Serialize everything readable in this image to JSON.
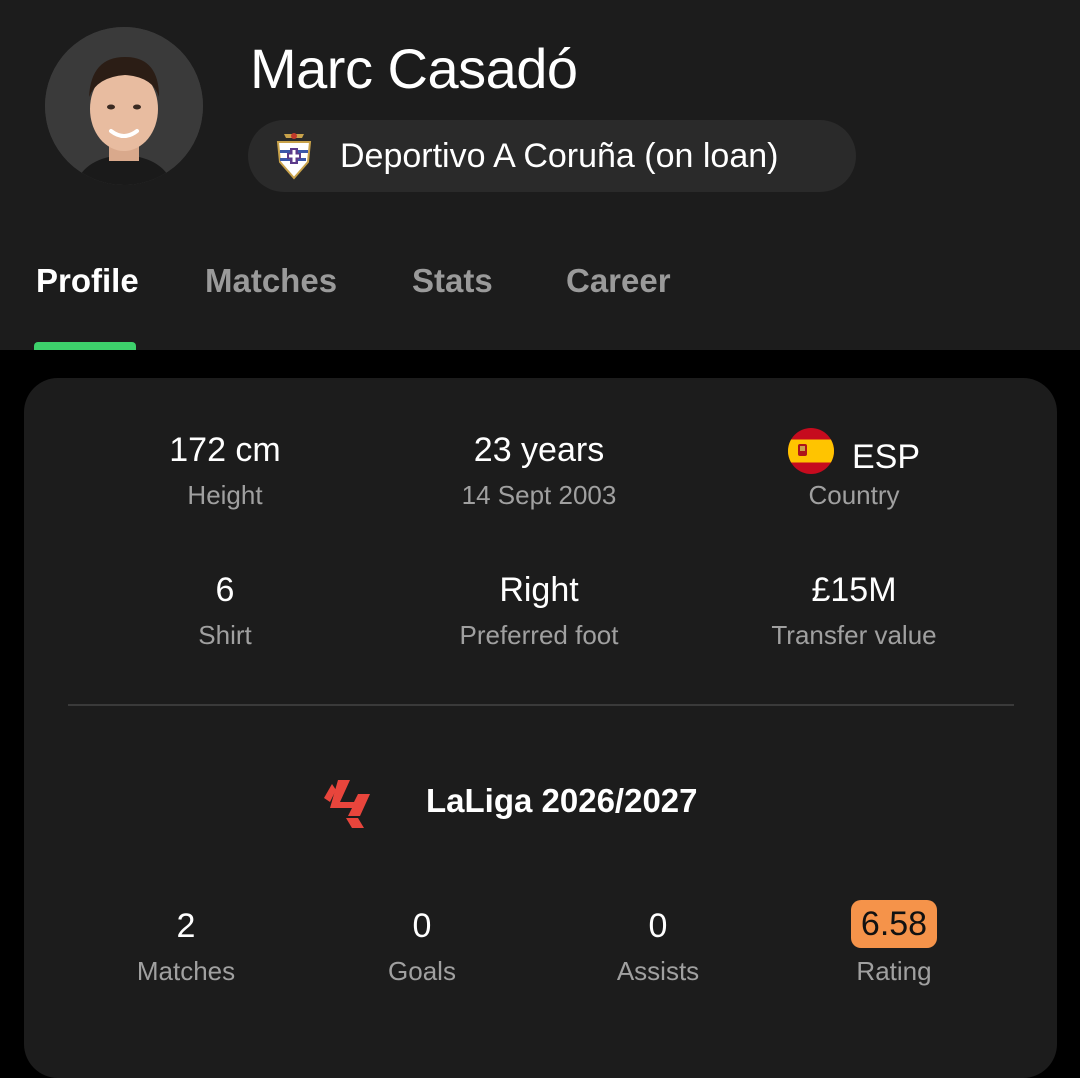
{
  "player": {
    "name": "Marc Casadó",
    "club": "Deportivo A Coruña (on loan)"
  },
  "tabs": [
    {
      "label": "Profile",
      "active": true
    },
    {
      "label": "Matches",
      "active": false
    },
    {
      "label": "Stats",
      "active": false
    },
    {
      "label": "Career",
      "active": false
    }
  ],
  "info": {
    "height": {
      "value": "172 cm",
      "label": "Height"
    },
    "age": {
      "value": "23 years",
      "label": "14 Sept 2003"
    },
    "country": {
      "value": "ESP",
      "label": "Country"
    },
    "shirt": {
      "value": "6",
      "label": "Shirt"
    },
    "foot": {
      "value": "Right",
      "label": "Preferred foot"
    },
    "transfer": {
      "value": "£15M",
      "label": "Transfer value"
    }
  },
  "season": {
    "league": "LaLiga 2026/2027",
    "matches": {
      "value": "2",
      "label": "Matches"
    },
    "goals": {
      "value": "0",
      "label": "Goals"
    },
    "assists": {
      "value": "0",
      "label": "Assists"
    },
    "rating": {
      "value": "6.58",
      "label": "Rating"
    }
  },
  "colors": {
    "accent": "#3dd16b",
    "rating_badge": "#f5934a",
    "league_logo": "#e8453c"
  },
  "icons": {
    "avatar": "player-photo",
    "club": "deportivo-crest-icon",
    "country": "spain-flag-icon",
    "league": "laliga-logo-icon"
  }
}
